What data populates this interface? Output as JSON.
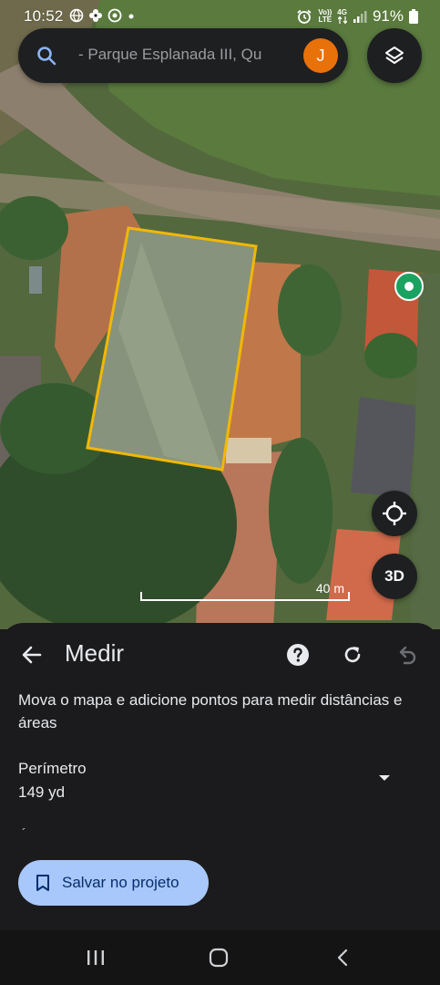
{
  "status_bar": {
    "time": "10:52",
    "network_tag_top": "Vo))",
    "network_tag_bottom": "LTE",
    "network_4g": "4G",
    "battery": "91%"
  },
  "search": {
    "text": "- Parque Esplanada III, Qu",
    "avatar_letter": "J"
  },
  "map": {
    "scale_label": "40 m",
    "btn_3d": "3D",
    "measure_outline_color": "#f2b705",
    "pin_color": "#1aa260"
  },
  "sheet": {
    "title": "Medir",
    "description": "Mova o mapa e adicione pontos para medir distâncias e áreas",
    "perimeter_label": "Perímetro",
    "perimeter_value": "149 yd",
    "mark": "´",
    "save_label": "Salvar no projeto"
  },
  "colors": {
    "sheet_bg": "#1b1b1d",
    "save_button_bg": "#a8c7fa",
    "avatar_bg": "#e8710a"
  }
}
